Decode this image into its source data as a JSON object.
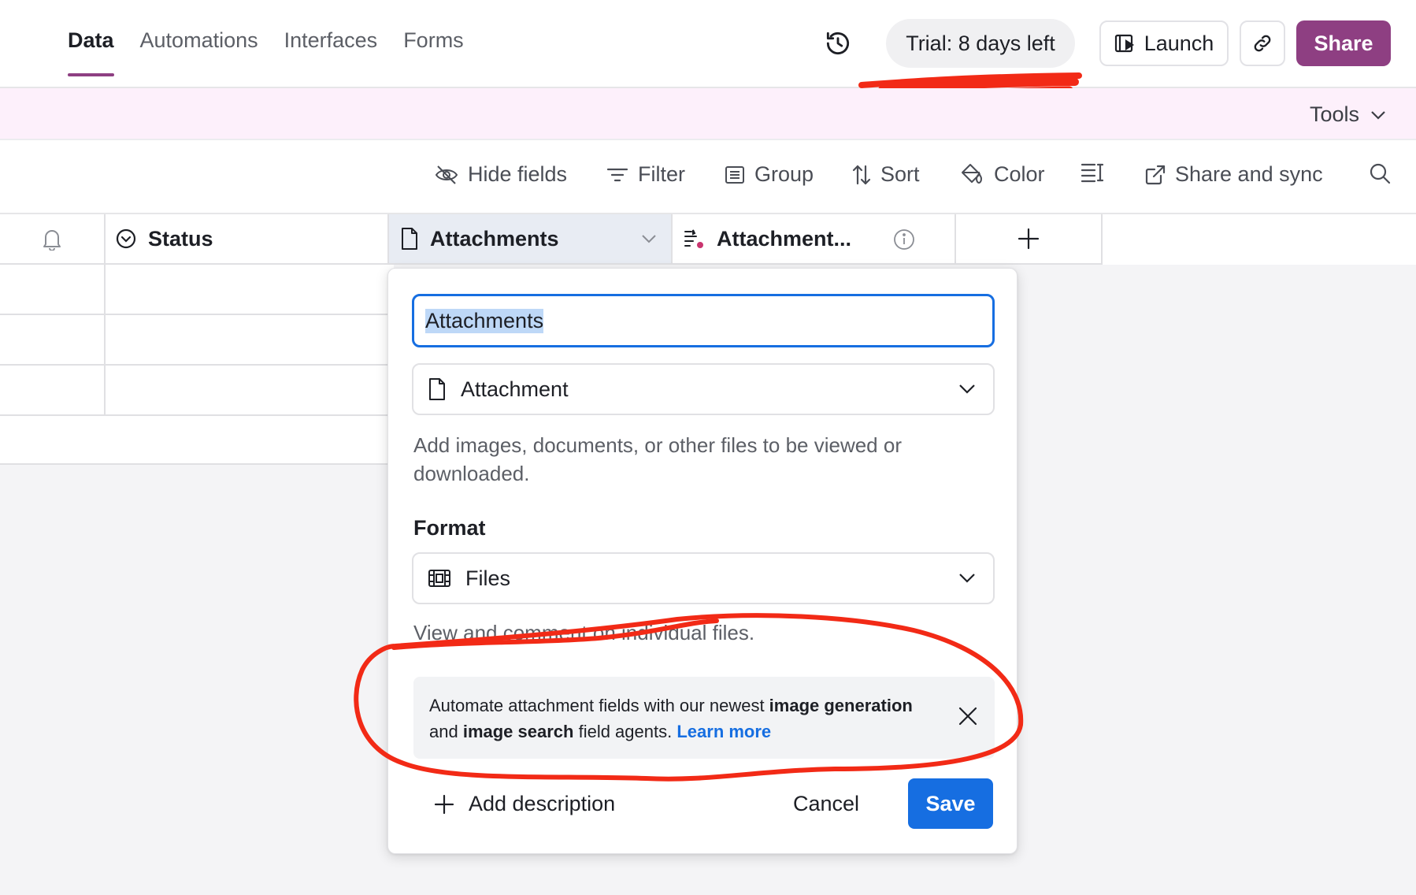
{
  "nav": {
    "tabs": [
      {
        "label": "Data",
        "active": true
      },
      {
        "label": "Automations",
        "active": false
      },
      {
        "label": "Interfaces",
        "active": false
      },
      {
        "label": "Forms",
        "active": false
      }
    ],
    "trial_label": "Trial: 8 days left",
    "launch_label": "Launch",
    "share_label": "Share"
  },
  "toolsbar": {
    "tools_label": "Tools"
  },
  "viewbar": {
    "hide_fields": "Hide fields",
    "filter": "Filter",
    "group": "Group",
    "sort": "Sort",
    "color": "Color",
    "share_sync": "Share and sync"
  },
  "grid": {
    "columns": [
      {
        "label": "Status",
        "icon": "status-circle-icon"
      },
      {
        "label": "Attachments",
        "icon": "file-icon"
      },
      {
        "label": "Attachment...",
        "icon": "ai-text-icon"
      }
    ]
  },
  "popover": {
    "field_name": "Attachments",
    "field_type": "Attachment",
    "type_description": "Add images, documents, or other files to be viewed or downloaded.",
    "format_label": "Format",
    "format_value": "Files",
    "format_description": "View and comment on individual files.",
    "banner": {
      "text_1": "Automate attachment fields with our newest ",
      "bold_1": "image generation",
      "text_2": " and ",
      "bold_2": "image search",
      "text_3": " field agents. ",
      "link": "Learn more"
    },
    "add_description": "Add description",
    "cancel": "Cancel",
    "save": "Save"
  },
  "colors": {
    "accent": "#8e3f82",
    "primary": "#166ee1",
    "annotation": "#f22a16"
  }
}
